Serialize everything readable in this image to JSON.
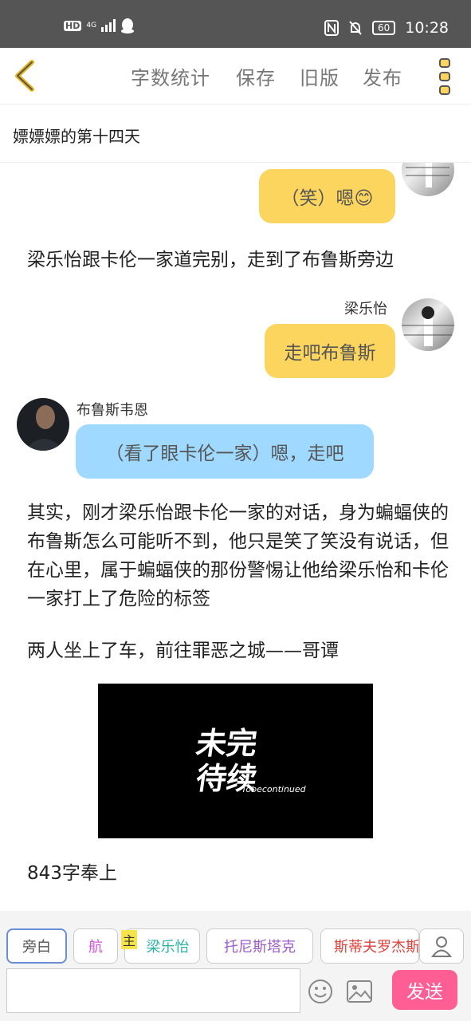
{
  "status": {
    "net": "HD",
    "signal": "4G",
    "battery": "60",
    "time": "10:28"
  },
  "toolbar": {
    "word_count": "字数统计",
    "save": "保存",
    "old_version": "旧版",
    "publish": "发布"
  },
  "chapter_title": "嫖嫖嫖的第十四天",
  "messages": {
    "m1": {
      "text": "（笑）嗯😊"
    },
    "narration1": "梁乐怡跟卡伦一家道完别，走到了布鲁斯旁边",
    "m2": {
      "name": "梁乐怡",
      "text": "走吧布鲁斯"
    },
    "m3": {
      "name": "布鲁斯韦恩",
      "text": "（看了眼卡伦一家）嗯，走吧"
    },
    "narration2": "其实，刚才梁乐怡跟卡伦一家的对话，身为蝙蝠侠的布鲁斯怎么可能听不到，他只是笑了笑没有说话，但在心里，属于蝙蝠侠的那份警惕让他给梁乐怡和卡伦一家打上了危险的标签",
    "narration3": "两人坐上了车，前往罪恶之城——哥谭",
    "image_text": {
      "line1": "未完",
      "line2": "待续",
      "en": "Tobecontinued"
    },
    "narration4": "843字奉上"
  },
  "characters": {
    "narrator": "旁白",
    "hang": "航",
    "main_tag": "主",
    "liang": "梁乐怡",
    "tony": "托尼斯塔克",
    "steve": "斯蒂夫罗杰斯"
  },
  "colors": {
    "hang": "#d653d6",
    "liang": "#2bb3a4",
    "tony": "#9c5bc9",
    "steve": "#e0413a",
    "send": "#ff5e95"
  },
  "input": {
    "value": "",
    "placeholder": ""
  },
  "send_label": "发送"
}
